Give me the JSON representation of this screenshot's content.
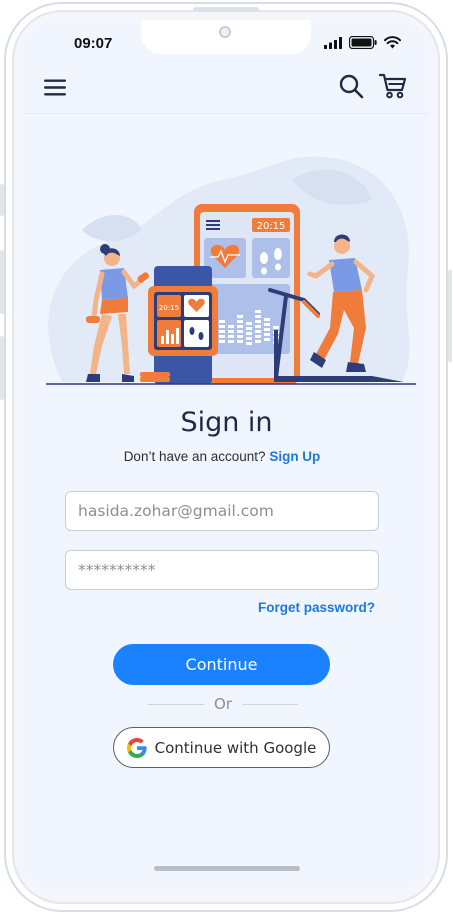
{
  "status_bar": {
    "time": "09:07"
  },
  "header": {
    "menu_icon": "hamburger-menu-icon",
    "search_icon": "search-icon",
    "cart_icon": "cart-icon"
  },
  "illustration": {
    "phone_time": "20:15",
    "watch_time": "20:15"
  },
  "signin": {
    "title": "Sign in",
    "no_account_text": "Don’t have an account?",
    "signup_link": "Sign Up",
    "email_value": "hasida.zohar@gmail.com",
    "password_value": "**********",
    "forgot_link": "Forget password?",
    "continue_label": "Continue",
    "or_label": "Or",
    "google_label": "Continue with Google"
  },
  "colors": {
    "accent": "#1a82ff",
    "link": "#1b7ae0",
    "background": "#f1f5fd",
    "illustration_orange": "#f07c3c",
    "illustration_blue": "#3b56a6"
  }
}
